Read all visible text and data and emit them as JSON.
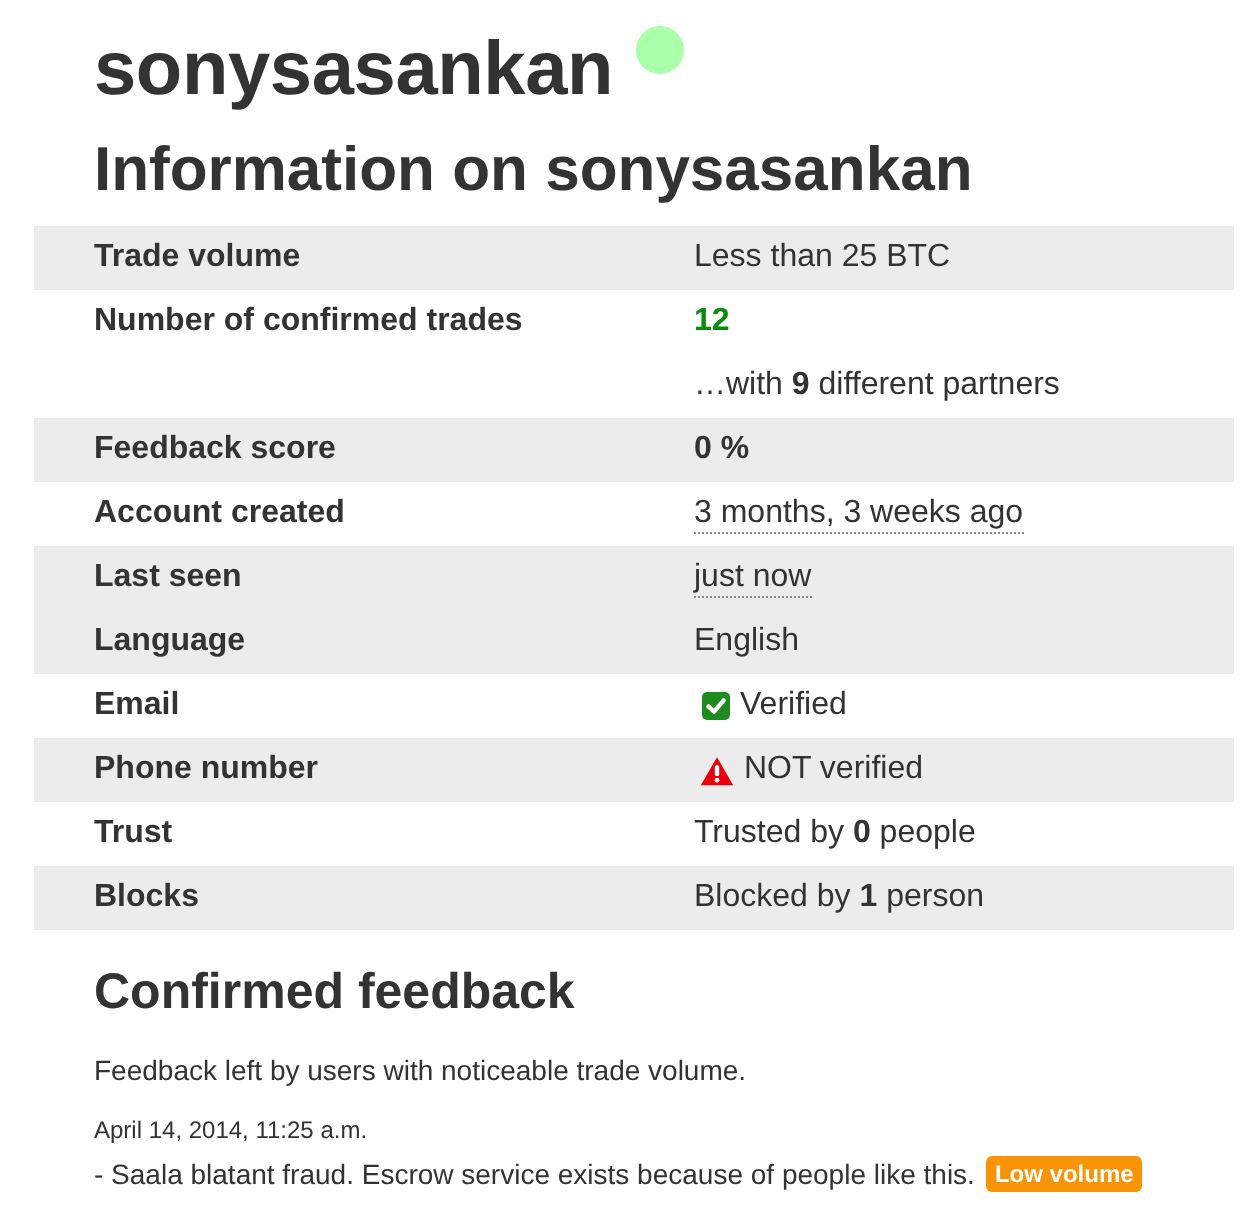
{
  "profile": {
    "username": "sonysasankan",
    "online": true
  },
  "info": {
    "heading": "Information on sonysasankan",
    "rows": [
      {
        "kind": "text",
        "label": "Trade volume",
        "value": "Less than 25 BTC",
        "shaded": true
      },
      {
        "kind": "trades",
        "label": "Number of confirmed trades",
        "value": "12",
        "note": "…with **9** different partners",
        "shaded": false
      },
      {
        "kind": "score",
        "label": "Feedback score",
        "value": "0 %",
        "shaded": true
      },
      {
        "kind": "time",
        "label": "Account created",
        "value": "3 months, 3 weeks ago",
        "shaded": false
      },
      {
        "kind": "time",
        "label": "Last seen",
        "value": "just now",
        "shaded": true
      },
      {
        "kind": "text",
        "label": "Language",
        "value": "English",
        "shaded": true
      },
      {
        "kind": "verification",
        "label": "Email",
        "value": "Verified",
        "verified": true,
        "shaded": false
      },
      {
        "kind": "verification",
        "label": "Phone number",
        "value": "NOT verified",
        "verified": false,
        "shaded": true
      },
      {
        "kind": "text",
        "label": "Trust",
        "value": "Trusted by **0** people",
        "shaded": false
      },
      {
        "kind": "text",
        "label": "Blocks",
        "value": "Blocked by **1** person",
        "shaded": true
      }
    ]
  },
  "feedback": {
    "heading": "Confirmed feedback",
    "description": "Feedback left by users with noticeable trade volume.",
    "entries": [
      {
        "date": "April 14, 2014, 11:25 a.m.",
        "text": "- Saala blatant fraud. Escrow service exists because of people like this.",
        "badge": "Low volume"
      }
    ]
  }
}
